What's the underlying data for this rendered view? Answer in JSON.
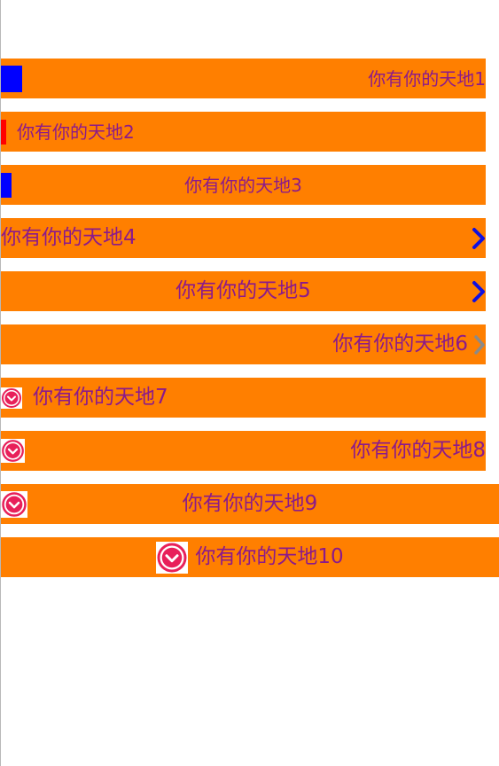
{
  "colors": {
    "row_bg": "#FF7F00",
    "text": "#8B1A8B",
    "indicator_blue": "#0000FF",
    "indicator_red": "#FF0000",
    "chevron_blue": "#1010E0",
    "chevron_gray": "#8A8A8A",
    "icon_pink": "#E8205A"
  },
  "rows": [
    {
      "label": "你有你的天地1",
      "icon": "blue-square-icon"
    },
    {
      "label": "你有你的天地2",
      "icon": "red-bar-icon"
    },
    {
      "label": "你有你的天地3",
      "icon": "blue-bar-icon"
    },
    {
      "label": "你有你的天地4",
      "icon": "chevron-right-icon"
    },
    {
      "label": "你有你的天地5",
      "icon": "chevron-right-icon"
    },
    {
      "label": "你有你的天地6",
      "icon": "chevron-right-icon"
    },
    {
      "label": "你有你的天地7",
      "icon": "heart-badge-icon"
    },
    {
      "label": "你有你的天地8",
      "icon": "heart-badge-icon"
    },
    {
      "label": "你有你的天地9",
      "icon": "heart-badge-icon"
    },
    {
      "label": "你有你的天地10",
      "icon": "heart-badge-icon"
    }
  ]
}
